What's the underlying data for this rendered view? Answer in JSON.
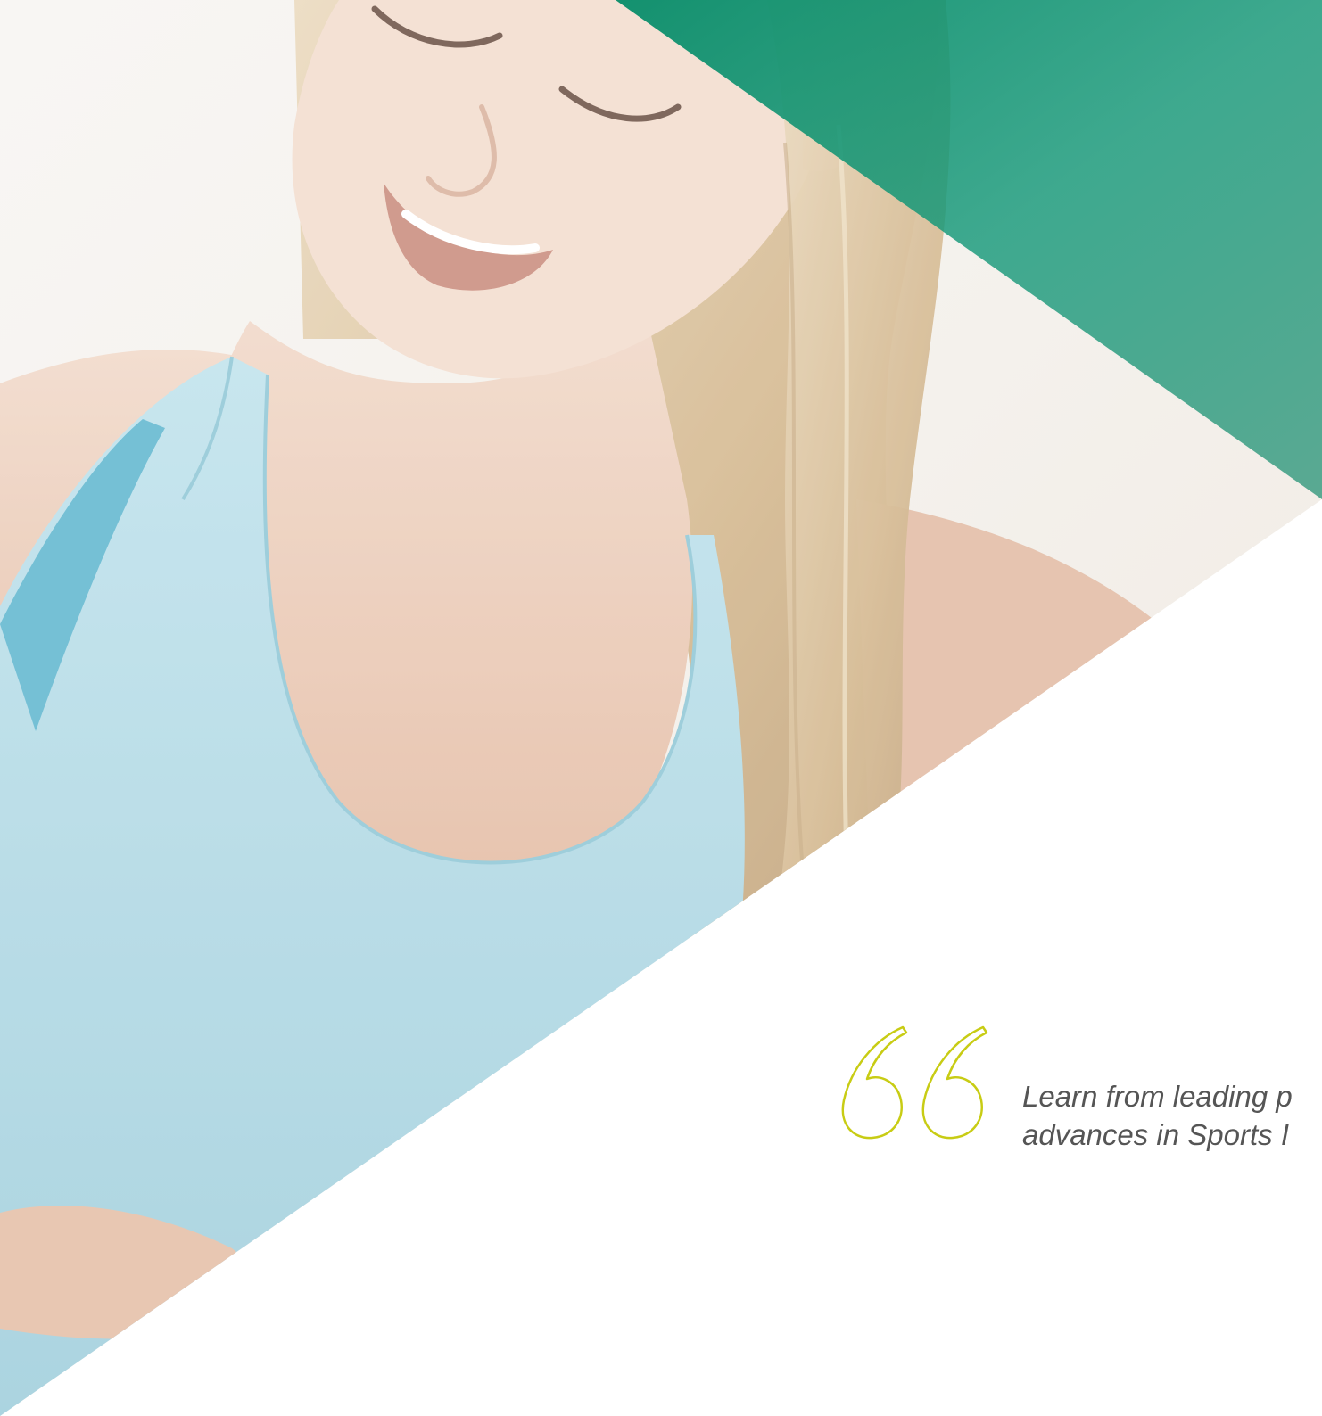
{
  "quote": {
    "line1": "Learn from leading p",
    "line2": "advances in Sports I"
  },
  "colors": {
    "brand_green": "#2fa28a",
    "brand_green_dark": "#0e7a5e",
    "quote_mark_yellow": "#c8cc14",
    "quote_text": "#555555",
    "tank_top": "#a9d5e2",
    "skin": "#e9c7b2",
    "hair": "#d8c29e"
  },
  "icons": {
    "quote_mark": "open-double-quote-outline"
  }
}
